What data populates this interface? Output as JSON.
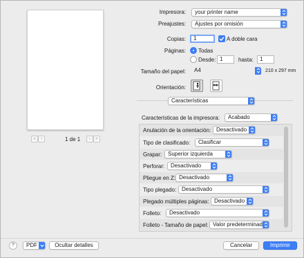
{
  "preview": {
    "page_label": "1 de 1",
    "first_label": "«",
    "prev_label": "‹",
    "next_label": "›",
    "last_label": "»"
  },
  "printer": {
    "label": "Impresora:",
    "value": "your printer name"
  },
  "presets": {
    "label": "Preajustes:",
    "value": "Ajustes por omisión"
  },
  "copies": {
    "label": "Copias:",
    "value": "1",
    "duplex_label": "A doble cara",
    "duplex_checked": true
  },
  "pages": {
    "label": "Páginas:",
    "all_label": "Todas",
    "from_label": "Desde:",
    "from_value": "1",
    "to_label": "hasta:",
    "to_value": "1",
    "selected": "all"
  },
  "paper": {
    "label": "Tamaño del papel:",
    "value": "A4",
    "dimensions": "210 x 297 mm"
  },
  "orientation": {
    "label": "Orientación:",
    "selected": "portrait"
  },
  "section": {
    "value": "Características"
  },
  "printer_features": {
    "label": "Características de la impresora:",
    "value": "Acabado"
  },
  "features": [
    {
      "label": "Anulación de la orientación:",
      "value": "Desactivado"
    },
    {
      "label": "Tipo de clasificado:",
      "value": "Clasificar"
    },
    {
      "label": "Grapar:",
      "value": "Superior izquierda"
    },
    {
      "label": "Perforar:",
      "value": "Desactivado"
    },
    {
      "label": "Pliegue en Z:",
      "value": "Desactivado"
    },
    {
      "label": "Tipo plegado:",
      "value": "Desactivado"
    },
    {
      "label": "Plegado múltiples páginas:",
      "value": "Desactivado"
    },
    {
      "label": "Folleto:",
      "value": "Desactivado"
    },
    {
      "label": "Folleto - Tamaño de papel:",
      "value": "Valor predeterminado..."
    }
  ],
  "bottom": {
    "help_label": "?",
    "pdf_label": "PDF",
    "hide_details_label": "Ocultar detalles",
    "cancel_label": "Cancelar",
    "print_label": "Imprimir"
  },
  "colors": {
    "accent": "#3d7ef6",
    "background": "#ececec",
    "panel": "#e4e4e4"
  }
}
